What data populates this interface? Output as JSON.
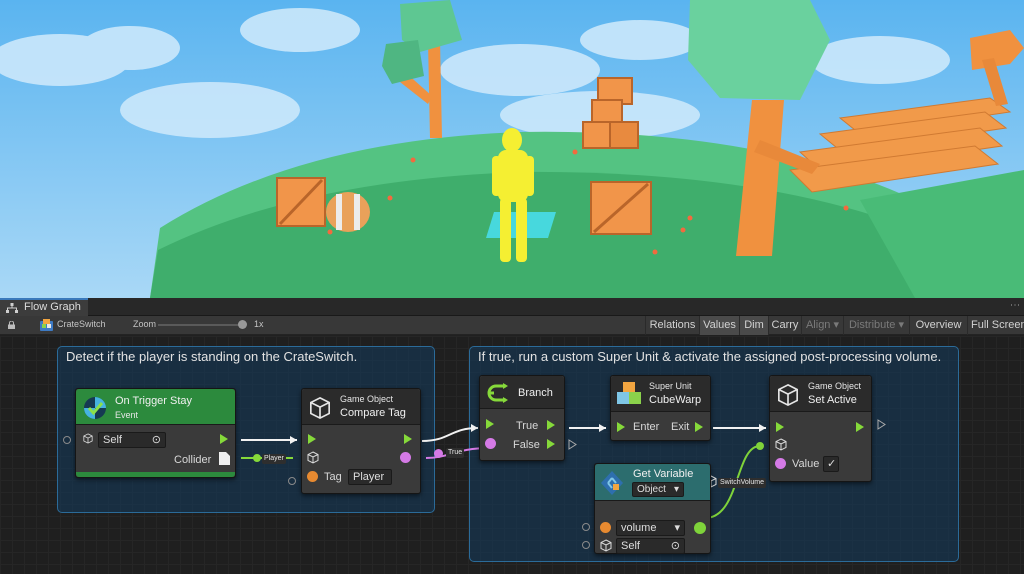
{
  "window": {
    "tab_label": "Flow Graph",
    "asset_name": "CrateSwitch",
    "zoom_label": "Zoom",
    "zoom_value": "1x",
    "zoom_level": 0.95
  },
  "toolbar": {
    "relations": "Relations",
    "values": "Values",
    "dim": "Dim",
    "carry": "Carry",
    "align": "Align",
    "distribute": "Distribute",
    "overview": "Overview",
    "full_screen": "Full Screen"
  },
  "groups": {
    "left_title": "Detect if the player is standing on the CrateSwitch.",
    "right_title": "If true, run a custom Super Unit & activate the assigned post-processing volume."
  },
  "nodes": {
    "trigger": {
      "title": "On Trigger Stay",
      "subtitle": "Event",
      "self_value": "Self",
      "collider_label": "Collider"
    },
    "compare": {
      "category": "Game Object",
      "title": "Compare Tag",
      "tag_label": "Tag",
      "tag_value": "Player"
    },
    "branch": {
      "title": "Branch",
      "true_label": "True",
      "false_label": "False"
    },
    "superunit": {
      "category": "Super Unit",
      "title": "CubeWarp",
      "enter_label": "Enter",
      "exit_label": "Exit"
    },
    "setactive": {
      "category": "Game Object",
      "title": "Set Active",
      "value_label": "Value",
      "value_check": "✓"
    },
    "getvariable": {
      "title": "Get Variable",
      "kind": "Object",
      "var_name": "volume",
      "self_value": "Self"
    }
  },
  "edge_labels": {
    "player": "Player",
    "true": "True",
    "switch_volume": "SwitchVolume"
  },
  "colors": {
    "control": "#86d93a",
    "object_port": "#e88a30",
    "bool_port": "#d57ae6",
    "unity_object_port": "#7fd33a",
    "group_border": "#2b6b99",
    "tab_accent": "#3a79bb"
  }
}
